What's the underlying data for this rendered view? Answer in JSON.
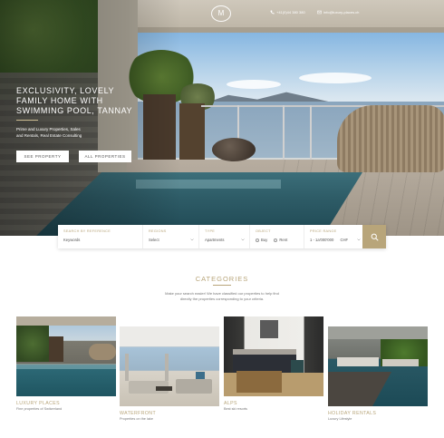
{
  "header": {
    "logo_text": "M",
    "phone": "+41(0)44 380 380",
    "email": "info@luxury-places.ch"
  },
  "hero": {
    "title_line1": "EXCLUSIVITY, LOVELY",
    "title_line2": "FAMILY HOME WITH",
    "title_line3": "SWIMMING POOL, TANNAY",
    "subtitle_line1": "Prime and Luxury Properties, Sales",
    "subtitle_line2": "and Rentals, Real Estate Consulting",
    "see_property_label": "SEE PROPERTY",
    "all_properties_label": "ALL PROPERTIES"
  },
  "search": {
    "reference": {
      "label": "SEARCH BY REFERENCE",
      "value": "Keywords"
    },
    "regions": {
      "label": "REGIONS",
      "value": "Select"
    },
    "type": {
      "label": "TYPE",
      "value": "Apartments"
    },
    "object": {
      "label": "OBJECT",
      "option1": "Buy",
      "option2": "Rent"
    },
    "price": {
      "label": "PRICE RANGE",
      "value": "1 - 1a'000'000",
      "currency": "CHF"
    }
  },
  "categories": {
    "title": "CATEGORIES",
    "description_line1": "Make your search easier! We have classified our properties to help find",
    "description_line2": "directly the properties corresponding to your criteria.",
    "items": [
      {
        "title": "LUXURY PLACES",
        "subtitle": "Fine properties of Switzerland"
      },
      {
        "title": "WATERFRONT",
        "subtitle": "Properties on the lake"
      },
      {
        "title": "ALPS",
        "subtitle": "Best ski resorts"
      },
      {
        "title": "HOLIDAY RENTALS",
        "subtitle": "Luxury Lifestyle"
      }
    ]
  },
  "colors": {
    "accent": "#b8a57a"
  },
  "icons": [
    "phone-icon",
    "email-icon",
    "search-icon",
    "chevron-down-icon"
  ]
}
